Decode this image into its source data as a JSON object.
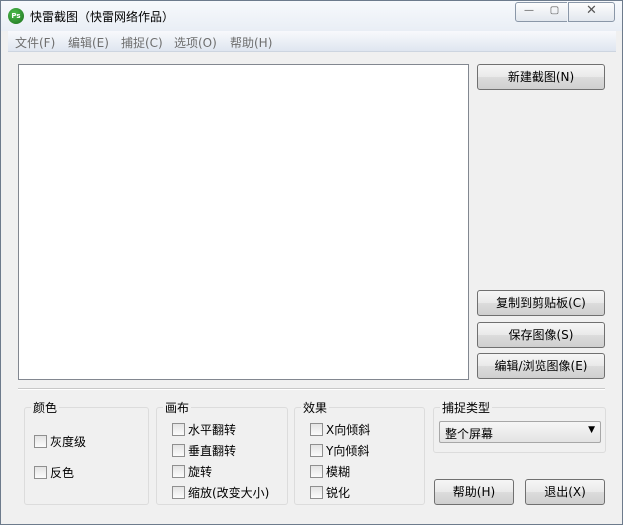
{
  "window": {
    "title": "快雷截图（快雷网络作品）",
    "controls": {
      "minimize": "—",
      "maximize": "▢",
      "close": "✕"
    }
  },
  "menu": [
    "文件(F)",
    "编辑(E)",
    "捕捉(C)",
    "选项(O)",
    "帮助(H)"
  ],
  "buttons": {
    "new_capture": "新建截图(N)",
    "copy_clipboard": "复制到剪贴板(C)",
    "save_image": "保存图像(S)",
    "edit_browse": "编辑/浏览图像(E)",
    "help": "帮助(H)",
    "exit": "退出(X)"
  },
  "groups": {
    "color": {
      "title": "颜色",
      "options": [
        "灰度级",
        "反色"
      ]
    },
    "canvas": {
      "title": "画布",
      "options": [
        "水平翻转",
        "垂直翻转",
        "旋转",
        "缩放(改变大小)"
      ]
    },
    "effects": {
      "title": "效果",
      "options": [
        "X向倾斜",
        "Y向倾斜",
        "模糊",
        "锐化"
      ]
    },
    "capture_type": {
      "title": "捕捉类型",
      "selected": "整个屏幕"
    }
  },
  "icons": {
    "app": "Ps",
    "dropdown": "▼"
  }
}
